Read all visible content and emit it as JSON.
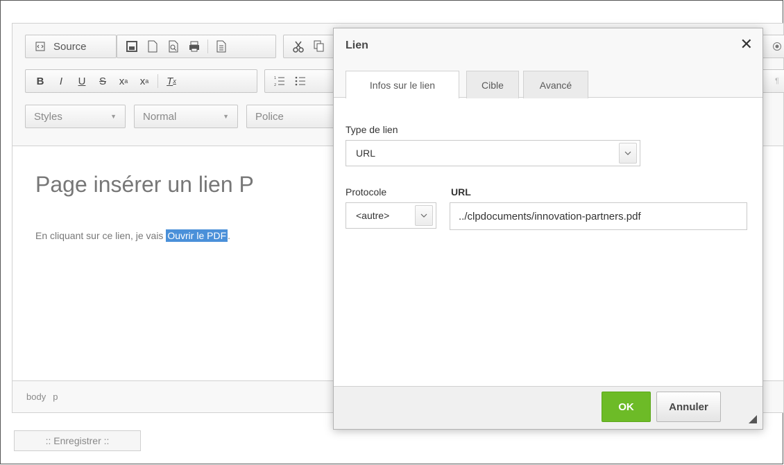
{
  "editor": {
    "toolbar": {
      "source_label": "Source",
      "styles_combo": "Styles",
      "format_combo": "Normal",
      "font_combo": "Police",
      "row1_icons": [
        "source-icon",
        "save-icon",
        "new-page-icon",
        "preview-icon",
        "print-icon",
        "templates-icon",
        "cut-icon"
      ],
      "row2_icons": [
        "bold-icon",
        "italic-icon",
        "underline-icon",
        "strike-icon",
        "subscript-icon",
        "superscript-icon",
        "remove-format-icon",
        "numbered-list-icon",
        "bulleted-list-icon"
      ]
    },
    "content": {
      "heading": "Page insérer un lien P",
      "paragraph_prefix": "En cliquant sur ce lien, je vais ",
      "link_text": "Ouvrir le PDF",
      "paragraph_suffix": "."
    },
    "status_path": [
      "body",
      "p"
    ]
  },
  "save_button": ":: Enregistrer ::",
  "dialog": {
    "title": "Lien",
    "close_glyph": "✕",
    "tabs": [
      {
        "label": "Infos sur le lien",
        "active": true
      },
      {
        "label": "Cible",
        "active": false
      },
      {
        "label": "Avancé",
        "active": false
      }
    ],
    "link_type_label": "Type de lien",
    "link_type_value": "URL",
    "protocol_label": "Protocole",
    "protocol_value": "<autre>",
    "url_label": "URL",
    "url_value": "../clpdocuments/innovation-partners.pdf",
    "ok_label": "OK",
    "cancel_label": "Annuler"
  },
  "colors": {
    "ok_button": "#6dbb27",
    "selection": "#4a90d9"
  }
}
